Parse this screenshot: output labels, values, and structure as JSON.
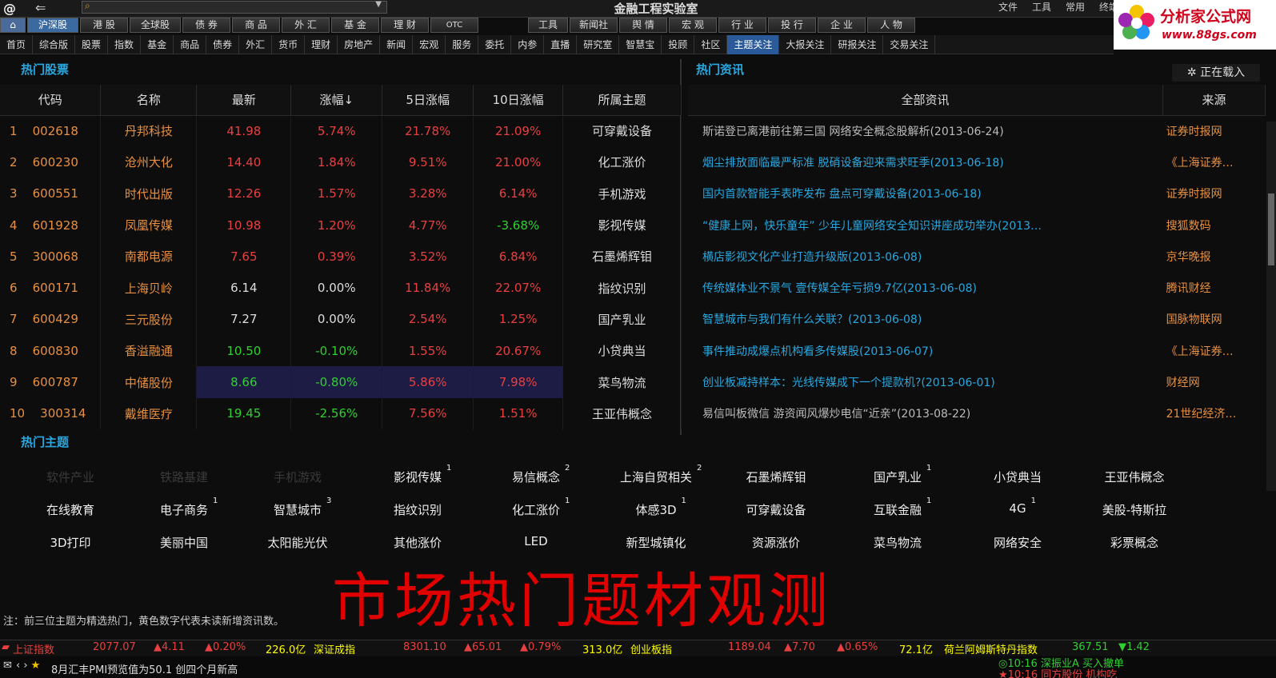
{
  "window": {
    "title": "金融工程实验室",
    "menu": [
      "文件",
      "工具",
      "常用",
      "终端"
    ]
  },
  "brand": {
    "name": "分析家公式网",
    "url": "www.88gs.com"
  },
  "market_tabs": [
    "沪深股",
    "港 股",
    "全球股",
    "债 券",
    "商 品",
    "外 汇",
    "基 金",
    "理 财",
    "OTC"
  ],
  "tool_tabs": [
    "工具",
    "新闻社",
    "舆 情",
    "宏 观",
    "行 业",
    "投 行",
    "企 业",
    "人 物"
  ],
  "nav": [
    "首页",
    "综合版",
    "股票",
    "指数",
    "基金",
    "商品",
    "债券",
    "外汇",
    "货币",
    "理财",
    "房地产",
    "新闻",
    "宏观",
    "服务",
    "委托",
    "内参",
    "直播",
    "研究室",
    "智慧宝",
    "投顾",
    "社区",
    "主题关注",
    "大报关注",
    "研报关注",
    "交易关注"
  ],
  "nav_active": "主题关注",
  "stocks": {
    "title": "热门股票",
    "headers": [
      "代码",
      "名称",
      "最新",
      "涨幅↓",
      "5日涨幅",
      "10日涨幅",
      "所属主题"
    ],
    "rows": [
      {
        "n": "1",
        "code": "002618",
        "name": "丹邦科技",
        "last": "41.98",
        "chg": "5.74%",
        "d5": "21.78%",
        "d10": "21.09%",
        "theme": "可穿戴设备"
      },
      {
        "n": "2",
        "code": "600230",
        "name": "沧州大化",
        "last": "14.40",
        "chg": "1.84%",
        "d5": "9.51%",
        "d10": "21.00%",
        "theme": "化工涨价"
      },
      {
        "n": "3",
        "code": "600551",
        "name": "时代出版",
        "last": "12.26",
        "chg": "1.57%",
        "d5": "3.28%",
        "d10": "6.14%",
        "theme": "手机游戏"
      },
      {
        "n": "4",
        "code": "601928",
        "name": "凤凰传媒",
        "last": "10.98",
        "chg": "1.20%",
        "d5": "4.77%",
        "d10": "-3.68%",
        "theme": "影视传媒"
      },
      {
        "n": "5",
        "code": "300068",
        "name": "南都电源",
        "last": "7.65",
        "chg": "0.39%",
        "d5": "3.52%",
        "d10": "6.84%",
        "theme": "石墨烯辉钼"
      },
      {
        "n": "6",
        "code": "600171",
        "name": "上海贝岭",
        "last": "6.14",
        "chg": "0.00%",
        "d5": "11.84%",
        "d10": "22.07%",
        "theme": "指纹识别"
      },
      {
        "n": "7",
        "code": "600429",
        "name": "三元股份",
        "last": "7.27",
        "chg": "0.00%",
        "d5": "2.54%",
        "d10": "1.25%",
        "theme": "国产乳业"
      },
      {
        "n": "8",
        "code": "600830",
        "name": "香溢融通",
        "last": "10.50",
        "chg": "-0.10%",
        "d5": "1.55%",
        "d10": "20.67%",
        "theme": "小贷典当"
      },
      {
        "n": "9",
        "code": "600787",
        "name": "中储股份",
        "last": "8.66",
        "chg": "-0.80%",
        "d5": "5.86%",
        "d10": "7.98%",
        "theme": "菜鸟物流"
      },
      {
        "n": "10",
        "code": "300314",
        "name": "戴维医疗",
        "last": "19.45",
        "chg": "-2.56%",
        "d5": "7.56%",
        "d10": "1.51%",
        "theme": "王亚伟概念"
      }
    ]
  },
  "news": {
    "title": "热门资讯",
    "loading": "正在载入",
    "headers": [
      "全部资讯",
      "来源"
    ],
    "rows": [
      {
        "t": "斯诺登已离港前往第三国 网络安全概念股解析(2013-06-24)",
        "s": "证券时报网",
        "grey": true
      },
      {
        "t": "烟尘排放面临最严标准 脱硝设备迎来需求旺季(2013-06-18)",
        "s": "《上海证券…",
        "grey": false
      },
      {
        "t": "国内首款智能手表昨发布 盘点可穿戴设备(2013-06-18)",
        "s": "证券时报网",
        "grey": false
      },
      {
        "t": "“健康上网，快乐童年” 少年儿童网络安全知识讲座成功举办(2013…",
        "s": "搜狐数码",
        "grey": false
      },
      {
        "t": "横店影视文化产业打造升级版(2013-06-08)",
        "s": "京华晚报",
        "grey": false
      },
      {
        "t": "传统媒体业不景气 壹传媒全年亏损9.7亿(2013-06-08)",
        "s": "腾讯财经",
        "grey": false
      },
      {
        "t": "智慧城市与我们有什么关联？(2013-06-08)",
        "s": "国脉物联网",
        "grey": false
      },
      {
        "t": "事件推动成爆点机构看多传媒股(2013-06-07)",
        "s": "《上海证券…",
        "grey": false
      },
      {
        "t": "创业板减持样本：光线传媒成下一个提款机?(2013-06-01)",
        "s": "财经网",
        "grey": false
      },
      {
        "t": "易信叫板微信 游资闻风爆炒电信“近亲”(2013-08-22)",
        "s": "21世纪经济…",
        "grey": true
      }
    ]
  },
  "topics": {
    "title": "热门主题",
    "rows": [
      [
        {
          "t": "软件产业",
          "dim": true,
          "sup": ""
        },
        {
          "t": "铁路基建",
          "dim": true,
          "sup": ""
        },
        {
          "t": "手机游戏",
          "dim": true,
          "sup": ""
        },
        {
          "t": "影视传媒",
          "dim": false,
          "sup": "1"
        },
        {
          "t": "易信概念",
          "dim": false,
          "sup": "2"
        },
        {
          "t": "上海自贸相关",
          "dim": false,
          "sup": "2"
        },
        {
          "t": "石墨烯辉钼",
          "dim": false,
          "sup": ""
        },
        {
          "t": "国产乳业",
          "dim": false,
          "sup": "1"
        },
        {
          "t": "小贷典当",
          "dim": false,
          "sup": ""
        },
        {
          "t": "王亚伟概念",
          "dim": false,
          "sup": ""
        }
      ],
      [
        {
          "t": "在线教育",
          "dim": false,
          "sup": ""
        },
        {
          "t": "电子商务",
          "dim": false,
          "sup": "1"
        },
        {
          "t": "智慧城市",
          "dim": false,
          "sup": "3"
        },
        {
          "t": "指纹识别",
          "dim": false,
          "sup": ""
        },
        {
          "t": "化工涨价",
          "dim": false,
          "sup": "1"
        },
        {
          "t": "体感3D",
          "dim": false,
          "sup": "1"
        },
        {
          "t": "可穿戴设备",
          "dim": false,
          "sup": ""
        },
        {
          "t": "互联金融",
          "dim": false,
          "sup": "1"
        },
        {
          "t": "4G",
          "dim": false,
          "sup": "1"
        },
        {
          "t": "美股-特斯拉",
          "dim": false,
          "sup": ""
        }
      ],
      [
        {
          "t": "3D打印",
          "dim": false,
          "sup": ""
        },
        {
          "t": "美丽中国",
          "dim": false,
          "sup": ""
        },
        {
          "t": "太阳能光伏",
          "dim": false,
          "sup": ""
        },
        {
          "t": "其他涨价",
          "dim": false,
          "sup": ""
        },
        {
          "t": "LED",
          "dim": false,
          "sup": ""
        },
        {
          "t": "新型城镇化",
          "dim": false,
          "sup": ""
        },
        {
          "t": "资源涨价",
          "dim": false,
          "sup": ""
        },
        {
          "t": "菜鸟物流",
          "dim": false,
          "sup": ""
        },
        {
          "t": "网络安全",
          "dim": false,
          "sup": ""
        },
        {
          "t": "彩票概念",
          "dim": false,
          "sup": ""
        }
      ]
    ],
    "note": "注：前三位主题为精选热门，黄色数字代表未读新增资讯数。"
  },
  "overlay": "市场热门题材观测",
  "ticker": {
    "items": [
      {
        "name": "上证指数",
        "val": "2077.07",
        "chg": "▲4.11",
        "pct": "▲0.20%",
        "amt": "226.0亿"
      },
      {
        "name": "深证成指",
        "val": "8301.10",
        "chg": "▲65.01",
        "pct": "▲0.79%",
        "amt": "313.0亿"
      },
      {
        "name": "创业板指",
        "val": "1189.04",
        "chg": "▲7.70",
        "pct": "▲0.65%",
        "amt": "72.1亿"
      },
      {
        "name": "荷兰阿姆斯特丹指数",
        "val": "367.51",
        "chg": "▼1.42",
        "pct": "",
        "amt": ""
      }
    ],
    "news": "8月汇丰PMI预览值为50.1 创四个月新高",
    "right1": "◎10:16 深振业A 买入撤单",
    "right2": "★10:16 同方股份 机构吃"
  },
  "colors": {
    "up": "#e84040",
    "down": "#30d030",
    "link": "#28a8e0",
    "source": "#e89040"
  }
}
